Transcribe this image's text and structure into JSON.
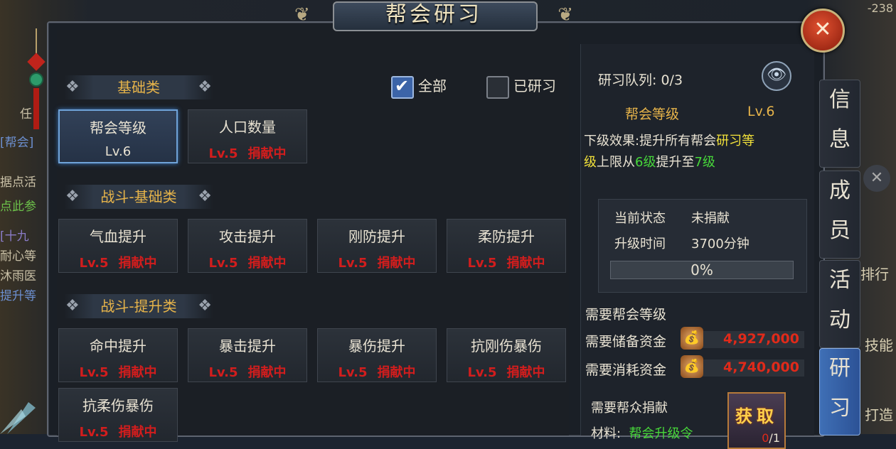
{
  "window": {
    "title": "帮会研习",
    "close_icon": "close-icon"
  },
  "filters": {
    "all_label": "全部",
    "all_checked": true,
    "researched_label": "已研习",
    "researched_checked": false
  },
  "sections": [
    {
      "header": "基础类",
      "items": [
        {
          "name": "帮会等级",
          "level": "Lv.6",
          "status": "",
          "selected": true
        },
        {
          "name": "人口数量",
          "level": "Lv.5",
          "status": "捐献中"
        }
      ]
    },
    {
      "header": "战斗-基础类",
      "items": [
        {
          "name": "气血提升",
          "level": "Lv.5",
          "status": "捐献中"
        },
        {
          "name": "攻击提升",
          "level": "Lv.5",
          "status": "捐献中"
        },
        {
          "name": "刚防提升",
          "level": "Lv.5",
          "status": "捐献中"
        },
        {
          "name": "柔防提升",
          "level": "Lv.5",
          "status": "捐献中"
        }
      ]
    },
    {
      "header": "战斗-提升类",
      "items": [
        {
          "name": "命中提升",
          "level": "Lv.5",
          "status": "捐献中"
        },
        {
          "name": "暴击提升",
          "level": "Lv.5",
          "status": "捐献中"
        },
        {
          "name": "暴伤提升",
          "level": "Lv.5",
          "status": "捐献中"
        },
        {
          "name": "抗刚伤暴伤",
          "level": "Lv.5",
          "status": "捐献中"
        },
        {
          "name": "抗柔伤暴伤",
          "level": "Lv.5",
          "status": "捐献中"
        }
      ]
    }
  ],
  "detail": {
    "queue_label": "研习队列:",
    "queue_value": "0/3",
    "name": "帮会等级",
    "level": "Lv.6",
    "effect_prefix": "下级效果:提升所有帮会",
    "effect_h1": "研习等",
    "effect_h2": "级",
    "effect_mid": "上限从",
    "effect_from": "6级",
    "effect_mid2": "提升至",
    "effect_to": "7级",
    "state_label": "当前状态",
    "state_value": "未捐献",
    "time_label": "升级时间",
    "time_value": "3700分钟",
    "progress": "0%",
    "req_guild_level": "需要帮会等级",
    "req_reserve_label": "需要储备资金",
    "req_reserve_value": "4,927,000",
    "req_consume_label": "需要消耗资金",
    "req_consume_value": "4,740,000",
    "req_donation": "需要帮众捐献",
    "material_label": "材料:",
    "material_value": "帮会升级令",
    "get_label": "获取",
    "get_have": "0",
    "get_need": "/1"
  },
  "tabs": [
    {
      "c1": "信",
      "c2": "息"
    },
    {
      "c1": "成",
      "c2": "员"
    },
    {
      "c1": "活",
      "c2": "动"
    },
    {
      "c1": "研",
      "c2": "习",
      "active": true
    }
  ],
  "background_left": [
    "任",
    "[帮会]",
    "据点活",
    "点此参",
    "[十九",
    "耐心等",
    "沐雨医",
    "提升等"
  ],
  "background_right": [
    "-238",
    "排行",
    "技能",
    "打造"
  ],
  "colors": {
    "accent_blue": "#3c64a8",
    "red_status": "#d21d1d",
    "gold": "#e7b44a",
    "green": "#47d83a",
    "yellow": "#f3e23a"
  }
}
